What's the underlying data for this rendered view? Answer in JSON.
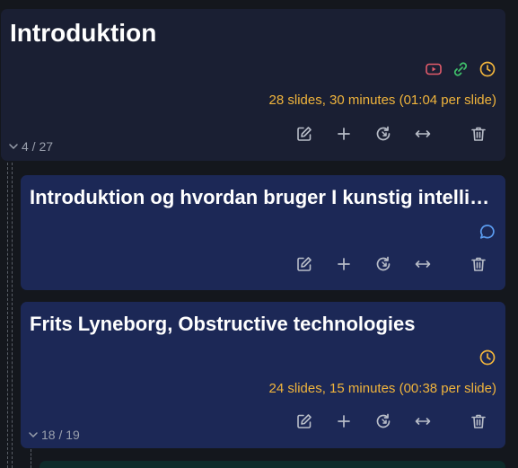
{
  "cards": [
    {
      "title": "Introduktion",
      "info": "28 slides, 30 minutes (01:04 per slide)",
      "counter": "4 / 27"
    },
    {
      "title": "Introduktion og hvordan bruger I kunstig intelligens"
    },
    {
      "title": "Frits Lyneborg, Obstructive technologies",
      "info": "24 slides, 15 minutes (00:38 per slide)",
      "counter": "18 / 19"
    }
  ],
  "colors": {
    "page_bg": "#14171d",
    "section_card": "#1a1f33",
    "slide_card": "#1c2856",
    "next_card": "#0e2b2a",
    "info_text": "#f0b43c",
    "video_icon": "#e25b6b",
    "link_icon": "#3fbf6a",
    "clock_icon": "#f0b43c",
    "comment_icon": "#5b9cf0"
  }
}
